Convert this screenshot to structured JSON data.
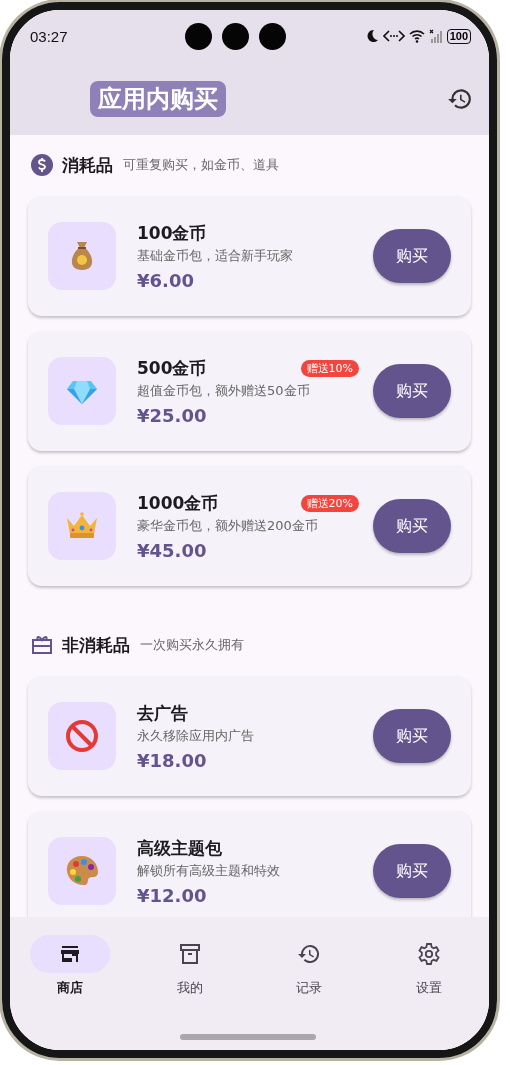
{
  "status_bar": {
    "time": "03:27",
    "battery": "100"
  },
  "app_bar": {
    "title": "应用内购买"
  },
  "sections": [
    {
      "kind": "coin",
      "title": "消耗品",
      "subtitle": "可重复购买，如金币、道具",
      "products": [
        {
          "kind": "moneybag",
          "name": "100金币",
          "description": "基础金币包，适合新手玩家",
          "price": "¥6.00",
          "button": "购买"
        },
        {
          "kind": "diamond",
          "name": "500金币",
          "bonus": "赠送10%",
          "description": "超值金币包，额外赠送50金币",
          "price": "¥25.00",
          "button": "购买"
        },
        {
          "kind": "crown",
          "name": "1000金币",
          "bonus": "赠送20%",
          "description": "豪华金币包，额外赠送200金币",
          "price": "¥45.00",
          "button": "购买"
        }
      ]
    },
    {
      "kind": "gift",
      "title": "非消耗品",
      "subtitle": "一次购买永久拥有",
      "products": [
        {
          "kind": "noentry",
          "name": "去广告",
          "description": "永久移除应用内广告",
          "price": "¥18.00",
          "button": "购买"
        },
        {
          "kind": "palette",
          "name": "高级主题包",
          "description": "解锁所有高级主题和特效",
          "price": "¥12.00",
          "button": "购买"
        }
      ]
    }
  ],
  "nav": [
    {
      "kind": "store",
      "label": "商店",
      "selected": true
    },
    {
      "kind": "box",
      "label": "我的",
      "selected": false
    },
    {
      "kind": "history",
      "label": "记录",
      "selected": false
    },
    {
      "kind": "settings",
      "label": "设置",
      "selected": false
    }
  ]
}
